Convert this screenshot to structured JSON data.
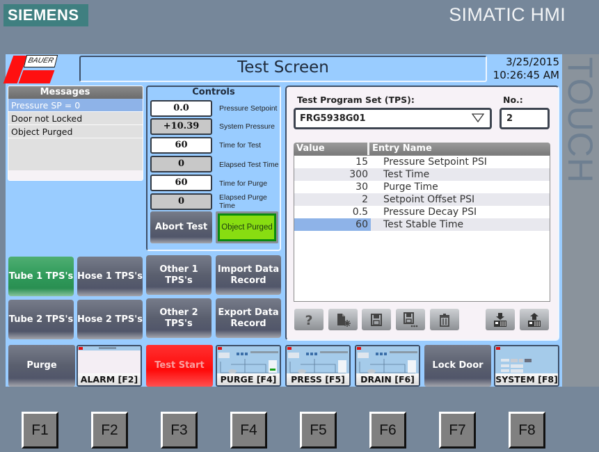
{
  "bezel": {
    "brand": "SIEMENS",
    "product": "SIMATIC HMI",
    "touch_label": "TOUCH",
    "function_keys": [
      "F1",
      "F2",
      "F3",
      "F4",
      "F5",
      "F6",
      "F7",
      "F8"
    ]
  },
  "header": {
    "logo_text": "BAUER",
    "title": "Test Screen",
    "date": "3/25/2015",
    "time": "10:26:45 AM"
  },
  "messages": {
    "title": "Messages",
    "items": [
      {
        "text": "Pressure SP = 0",
        "selected": true
      },
      {
        "text": "Door not Locked",
        "selected": false
      },
      {
        "text": "Object Purged",
        "selected": false
      }
    ]
  },
  "controls": {
    "title": "Controls",
    "fields": [
      {
        "value": "0.0",
        "label": "Pressure Setpoint",
        "editable": true
      },
      {
        "value": "+10.39",
        "label": "System Pressure",
        "editable": false
      },
      {
        "value": "60",
        "label": "Time for Test",
        "editable": true
      },
      {
        "value": "0",
        "label": "Elapsed Test Time",
        "editable": false
      },
      {
        "value": "60",
        "label": "Time for Purge",
        "editable": true
      },
      {
        "value": "0",
        "label": "Elapsed Purge Time",
        "editable": false
      }
    ],
    "abort_button": "Abort Test",
    "object_purged_indicator": "Object Purged",
    "colors": {
      "indicator_on": "#88dd11",
      "indicator_border": "#0a8a10"
    }
  },
  "tps": {
    "set_label": "Test Program Set (TPS):",
    "set_value": "FRG5938G01",
    "no_label": "No.:",
    "no_value": "2",
    "table": {
      "columns": [
        "Value",
        "Entry Name"
      ],
      "rows": [
        {
          "value": "15",
          "name": "Pressure Setpoint PSI"
        },
        {
          "value": "300",
          "name": "Test Time"
        },
        {
          "value": "30",
          "name": "Purge Time"
        },
        {
          "value": "2",
          "name": "Setpoint Offset PSI"
        },
        {
          "value": "0.5",
          "name": "Pressure Decay PSI"
        },
        {
          "value": "60",
          "name": "Test Stable Time",
          "selected": true
        }
      ]
    },
    "toolbar": [
      "help-icon",
      "new-record-icon",
      "save-icon",
      "save-as-icon",
      "delete-icon",
      "import-to-plc-icon",
      "export-from-plc-icon"
    ]
  },
  "categories": {
    "buttons": [
      {
        "label": "Tube 1 TPS's",
        "active": true
      },
      {
        "label": "Hose 1 TPS's",
        "active": false
      },
      {
        "label": "Other 1 TPS's",
        "active": false
      },
      {
        "label": "Import Data Record",
        "active": false
      },
      {
        "label": "Tube 2 TPS's",
        "active": false
      },
      {
        "label": "Hose 2 TPS's",
        "active": false
      },
      {
        "label": "Other 2 TPS's",
        "active": false
      },
      {
        "label": "Export Data Record",
        "active": false
      }
    ]
  },
  "nav": {
    "purge": "Purge",
    "alarm": "ALARM [F2]",
    "test_start": "Test Start",
    "purge_screen": "PURGE [F4]",
    "press_screen": "PRESS [F5]",
    "drain_screen": "DRAIN [F6]",
    "lock_door": "Lock Door",
    "system_screen": "SYSTEM [F8]"
  }
}
